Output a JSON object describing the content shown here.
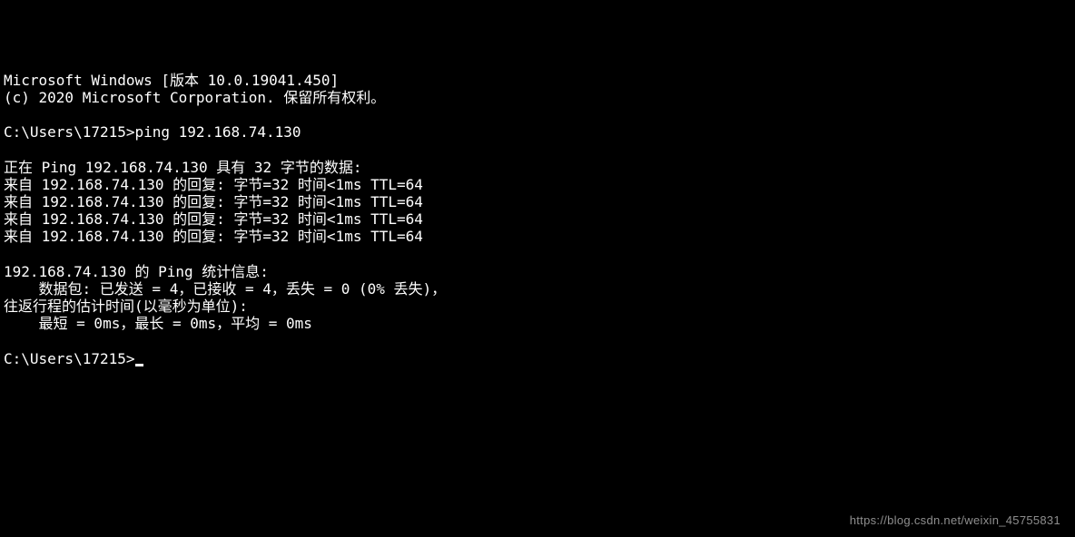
{
  "header": {
    "version_line": "Microsoft Windows [版本 10.0.19041.450]",
    "copyright_line": "(c) 2020 Microsoft Corporation. 保留所有权利。"
  },
  "command": {
    "prompt1": "C:\\Users\\17215>",
    "cmd1": "ping 192.168.74.130"
  },
  "ping": {
    "start_line": "正在 Ping 192.168.74.130 具有 32 字节的数据:",
    "reply1": "来自 192.168.74.130 的回复: 字节=32 时间<1ms TTL=64",
    "reply2": "来自 192.168.74.130 的回复: 字节=32 时间<1ms TTL=64",
    "reply3": "来自 192.168.74.130 的回复: 字节=32 时间<1ms TTL=64",
    "reply4": "来自 192.168.74.130 的回复: 字节=32 时间<1ms TTL=64"
  },
  "stats": {
    "header": "192.168.74.130 的 Ping 统计信息:",
    "packets": "    数据包: 已发送 = 4，已接收 = 4，丢失 = 0 (0% 丢失)，",
    "rtt_header": "往返行程的估计时间(以毫秒为单位):",
    "rtt_values": "    最短 = 0ms，最长 = 0ms，平均 = 0ms"
  },
  "prompt": {
    "prompt2": "C:\\Users\\17215>"
  },
  "watermark": {
    "text": "https://blog.csdn.net/weixin_45755831"
  }
}
